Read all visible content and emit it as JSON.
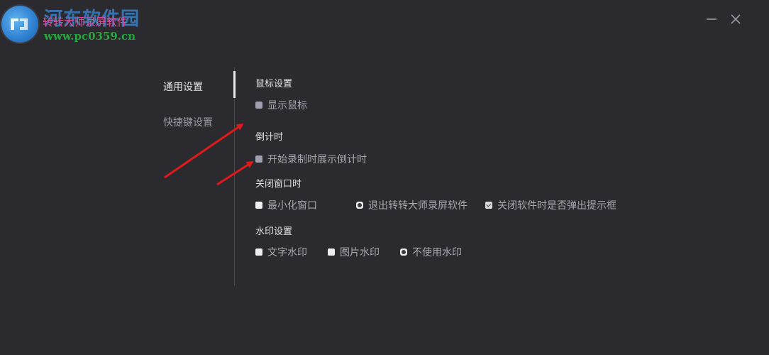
{
  "titlebar": {
    "watermark_site": "河东软件园",
    "app_title": "转转大师录屏软件",
    "watermark_url": "www.pc0359.cn",
    "minimize_symbol": "—",
    "close_symbol": "✕"
  },
  "sidebar": {
    "items": [
      {
        "label": "通用设置",
        "active": true
      },
      {
        "label": "快捷键设置",
        "active": false
      }
    ]
  },
  "settings": {
    "mouse": {
      "title": "鼠标设置",
      "show_mouse": {
        "label": "显示鼠标",
        "checked": false
      }
    },
    "countdown": {
      "title": "倒计时",
      "show_countdown": {
        "label": "开始录制时展示倒计时",
        "checked": false
      }
    },
    "close_window": {
      "title": "关闭窗口时",
      "options": [
        {
          "label": "最小化窗口",
          "selected": false
        },
        {
          "label": "退出转转大师录屏软件",
          "selected": true
        }
      ],
      "prompt_on_close": {
        "label": "关闭软件时是否弹出提示框",
        "checked": true
      }
    },
    "watermark": {
      "title": "水印设置",
      "options": [
        {
          "label": "文字水印",
          "selected": false
        },
        {
          "label": "图片水印",
          "selected": false
        },
        {
          "label": "不使用水印",
          "selected": true
        }
      ]
    }
  },
  "colors": {
    "background": "#2b2a2f",
    "arrow": "#e0191b",
    "title_text": "#e04c9c",
    "watermark_url": "#25a83a"
  }
}
